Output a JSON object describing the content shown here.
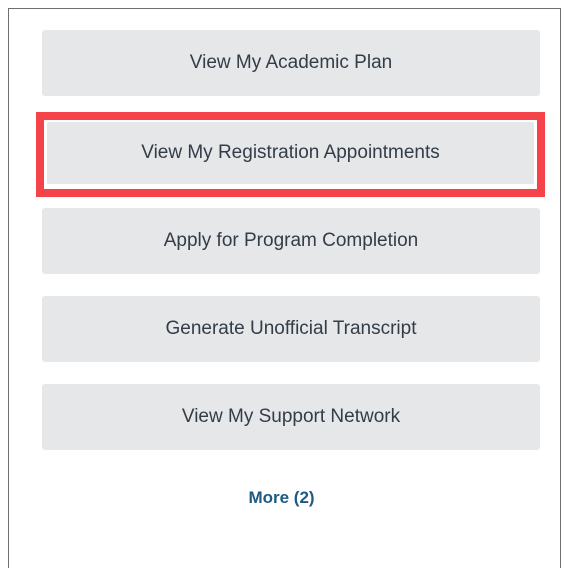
{
  "actions": [
    {
      "label": "View My Academic Plan"
    },
    {
      "label": "View My Registration Appointments"
    },
    {
      "label": "Apply for Program Completion"
    },
    {
      "label": "Generate Unofficial Transcript"
    },
    {
      "label": "View My Support Network"
    }
  ],
  "more_link": {
    "label": "More (2)"
  },
  "colors": {
    "button_bg": "#e5e7e9",
    "button_text": "#333d47",
    "highlight_border": "#f5434a",
    "link": "#1f5a82"
  }
}
